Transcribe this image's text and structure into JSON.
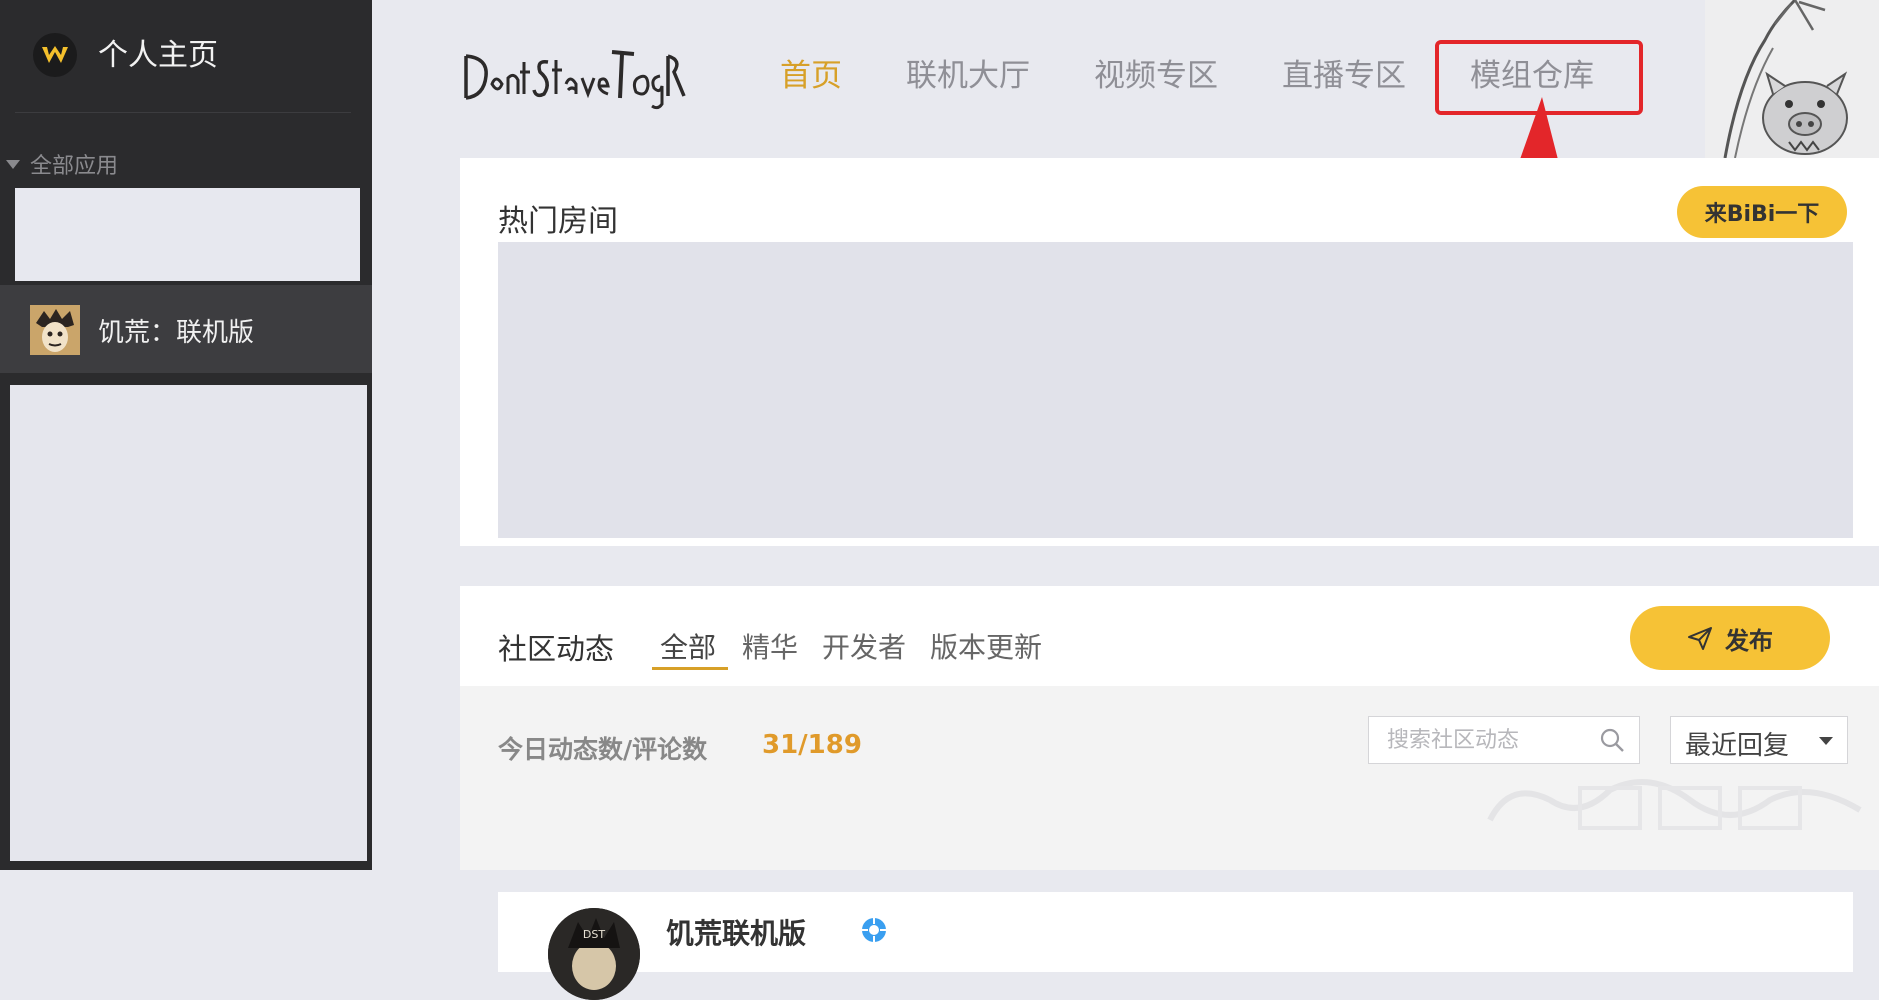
{
  "sidebar": {
    "title": "个人主页",
    "section_label": "全部应用",
    "game_label": "饥荒：联机版"
  },
  "brand": {
    "logo_text": "Don't Starve Together"
  },
  "nav": {
    "items": [
      "首页",
      "联机大厅",
      "视频专区",
      "直播专区",
      "模组仓库"
    ],
    "active_index": 0,
    "highlighted_index": 4
  },
  "hot_rooms": {
    "title": "热门房间",
    "bibi_button": "来BiBi一下"
  },
  "community": {
    "title": "社区动态",
    "tabs": [
      "全部",
      "精华",
      "开发者",
      "版本更新"
    ],
    "active_tab": 0,
    "publish_button": "发布",
    "stat_label": "今日动态数/评论数",
    "stat_value": "31/189",
    "search_placeholder": "搜索社区动态",
    "sort_selected": "最近回复",
    "post": {
      "author": "饥荒联机版"
    }
  },
  "colors": {
    "accent": "#d7a028",
    "button_yellow": "#f6c236",
    "highlight_red": "#e3262a",
    "sidebar_bg": "#2b2b2d"
  }
}
